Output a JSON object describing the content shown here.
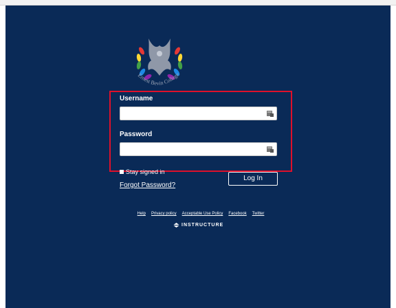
{
  "logo": {
    "college_name": "Ernest Bevin College"
  },
  "form": {
    "username_label": "Username",
    "username_value": "",
    "password_label": "Password",
    "password_value": "",
    "stay_signed_in_label": "Stay signed in",
    "forgot_password_label": "Forgot Password?",
    "login_button_label": "Log In"
  },
  "footer": {
    "links": [
      "Help",
      "Privacy policy",
      "Acceptable Use Policy",
      "Facebook",
      "Twitter"
    ],
    "brand": "INSTRUCTURE"
  },
  "colors": {
    "background": "#0a2a57",
    "highlight_border": "#e0102a",
    "text": "#ffffff"
  }
}
